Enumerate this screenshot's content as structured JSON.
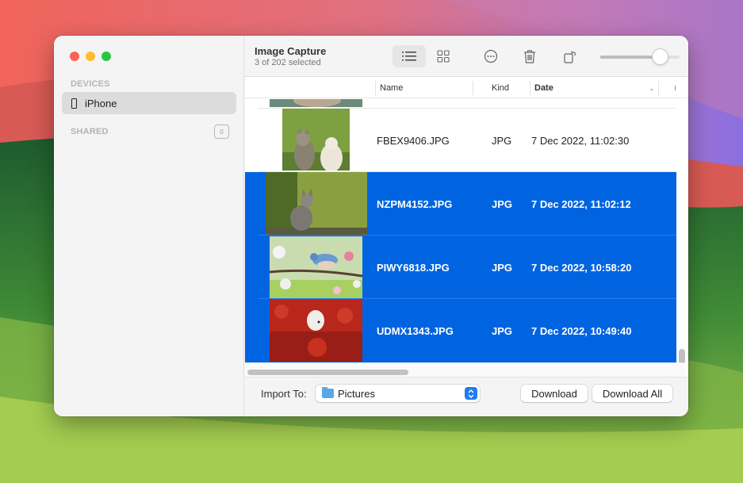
{
  "app": {
    "title": "Image Capture",
    "subtitle": "3 of 202 selected"
  },
  "sidebar": {
    "devices_label": "DEVICES",
    "devices": [
      {
        "label": "iPhone",
        "icon": "iphone-icon",
        "selected": true
      }
    ],
    "shared_label": "SHARED",
    "shared_count": "0"
  },
  "toolbar": {
    "buttons": [
      {
        "name": "list-view",
        "icon": "list-icon",
        "active": true
      },
      {
        "name": "grid-view",
        "icon": "grid-icon",
        "active": false
      },
      {
        "name": "more",
        "icon": "ellipsis-circle-icon"
      },
      {
        "name": "delete",
        "icon": "trash-icon"
      },
      {
        "name": "rotate",
        "icon": "rotate-left-icon"
      }
    ],
    "thumbnail_size": 0.82
  },
  "table": {
    "columns": [
      {
        "label": "Name"
      },
      {
        "label": "Kind"
      },
      {
        "label": "Date",
        "sorted": true
      }
    ],
    "rows": [
      {
        "name": "FBEX9406.JPG",
        "kind": "JPG",
        "date": "7 Dec 2022, 11:02:30",
        "selected": false,
        "thumb": "kittens"
      },
      {
        "name": "NZPM4152.JPG",
        "kind": "JPG",
        "date": "7 Dec 2022, 11:02:12",
        "selected": true,
        "thumb": "kitten-tree"
      },
      {
        "name": "PIWY6818.JPG",
        "kind": "JPG",
        "date": "7 Dec 2022, 10:58:20",
        "selected": true,
        "thumb": "bird-blossom"
      },
      {
        "name": "UDMX1343.JPG",
        "kind": "JPG",
        "date": "7 Dec 2022, 10:49:40",
        "selected": true,
        "thumb": "dog-flowers"
      }
    ]
  },
  "footer": {
    "import_label": "Import To:",
    "import_value": "Pictures",
    "download_label": "Download",
    "download_all_label": "Download All"
  },
  "colors": {
    "selection": "#0064e1",
    "close": "#fe5f57",
    "minimize": "#febc2e",
    "zoom": "#28c840"
  }
}
